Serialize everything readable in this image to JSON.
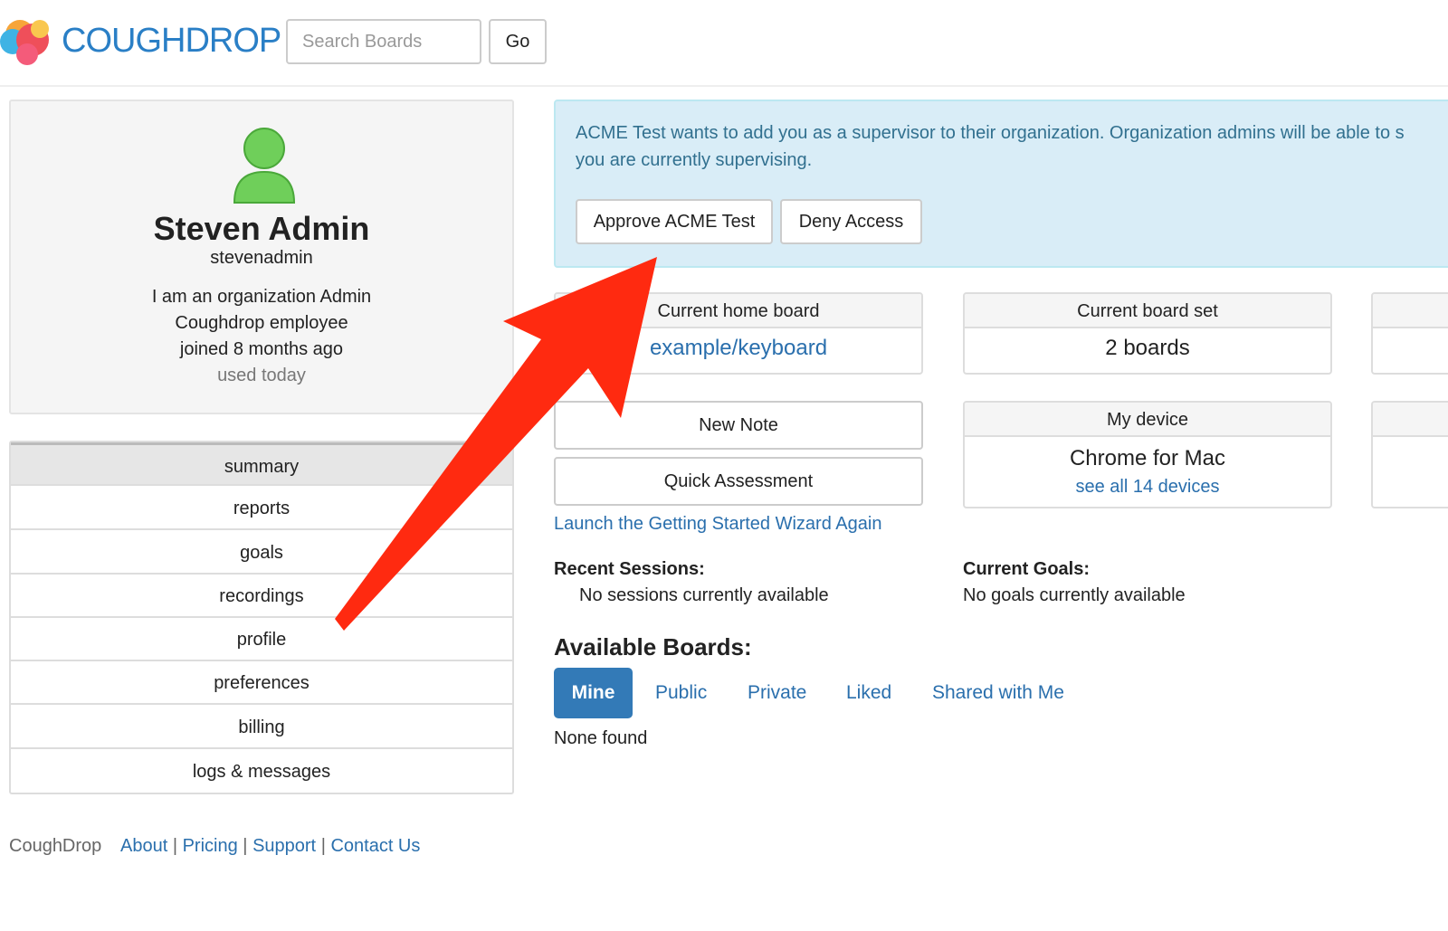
{
  "header": {
    "logo_text": "COUGHDROP",
    "search_placeholder": "Search Boards",
    "go_label": "Go"
  },
  "profile": {
    "name": "Steven Admin",
    "username": "stevenadmin",
    "lines": [
      "I am an organization Admin",
      "Coughdrop employee",
      "joined 8 months ago"
    ],
    "used": "used today"
  },
  "nav": {
    "items": [
      "summary",
      "reports",
      "goals",
      "recordings",
      "profile",
      "preferences",
      "billing",
      "logs & messages"
    ],
    "active": "summary"
  },
  "alert": {
    "line1": "ACME Test wants to add you as a supervisor to their organization. Organization admins will be able to s",
    "line2": "you are currently supervising.",
    "approve_label": "Approve ACME Test",
    "deny_label": "Deny Access"
  },
  "home_board": {
    "title": "Current home board",
    "value": "example/keyboard"
  },
  "board_set": {
    "title": "Current board set",
    "value": "2 boards"
  },
  "new_note_label": "New Note",
  "quick_assessment_label": "Quick Assessment",
  "wizard_link": "Launch the Getting Started Wizard Again",
  "device": {
    "title": "My device",
    "name": "Chrome for Mac",
    "link": "see all 14 devices"
  },
  "sessions": {
    "label": "Recent Sessions:",
    "value": "No sessions currently available"
  },
  "goals": {
    "label": "Current Goals:",
    "value": "No goals currently available"
  },
  "boards": {
    "heading": "Available Boards:",
    "tabs": [
      "Mine",
      "Public",
      "Private",
      "Liked",
      "Shared with Me"
    ],
    "active_tab": "Mine",
    "empty": "None found"
  },
  "footer": {
    "brand": "CoughDrop",
    "links": [
      "About",
      "Pricing",
      "Support",
      "Contact Us"
    ],
    "separator": "|"
  },
  "colors": {
    "brand_blue": "#2a7fc6",
    "link_blue": "#2a6fad",
    "primary_button": "#337ab7",
    "alert_bg": "#d9edf7",
    "annotation_arrow": "#ff2a10",
    "avatar_green": "#6fcf5a"
  }
}
